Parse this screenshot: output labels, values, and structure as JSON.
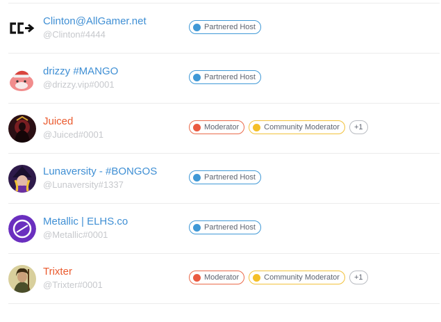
{
  "colors": {
    "name_blue": "#3f8fd4",
    "name_orange": "#ea5a2e",
    "tag_gray": "#c6c8cc",
    "host_blue": "#3f98d6",
    "mod_red": "#ea5a40",
    "community_yellow": "#f4bf28"
  },
  "members": [
    {
      "name": "Clinton@AllGamer.net",
      "tag": "@Clinton#4444",
      "name_color": "blue",
      "avatar_icon": "cc-logo-icon",
      "badges": [
        {
          "label": "Partnered Host",
          "kind": "blue"
        }
      ]
    },
    {
      "name": "drizzy #MANGO",
      "tag": "@drizzy.vip#0001",
      "name_color": "blue",
      "avatar_icon": "pink-blob-santa-icon",
      "badges": [
        {
          "label": "Partnered Host",
          "kind": "blue"
        }
      ]
    },
    {
      "name": "Juiced",
      "tag": "@Juiced#0001",
      "name_color": "orange",
      "avatar_icon": "dark-character-avatar",
      "badges": [
        {
          "label": "Moderator",
          "kind": "red"
        },
        {
          "label": "Community Moderator",
          "kind": "yellow"
        }
      ],
      "more": "+1"
    },
    {
      "name": "Lunaversity - #BONGOS",
      "tag": "@Lunaversity#1337",
      "name_color": "blue",
      "avatar_icon": "witch-character-avatar",
      "badges": [
        {
          "label": "Partnered Host",
          "kind": "blue"
        }
      ]
    },
    {
      "name": "Metallic | ELHS.co",
      "tag": "@Metallic#0001",
      "name_color": "blue",
      "avatar_icon": "purple-logo-avatar",
      "badges": [
        {
          "label": "Partnered Host",
          "kind": "blue"
        }
      ]
    },
    {
      "name": "Trixter",
      "tag": "@Trixter#0001",
      "name_color": "orange",
      "avatar_icon": "warrior-character-avatar",
      "badges": [
        {
          "label": "Moderator",
          "kind": "red"
        },
        {
          "label": "Community Moderator",
          "kind": "yellow"
        }
      ],
      "more": "+1"
    }
  ]
}
